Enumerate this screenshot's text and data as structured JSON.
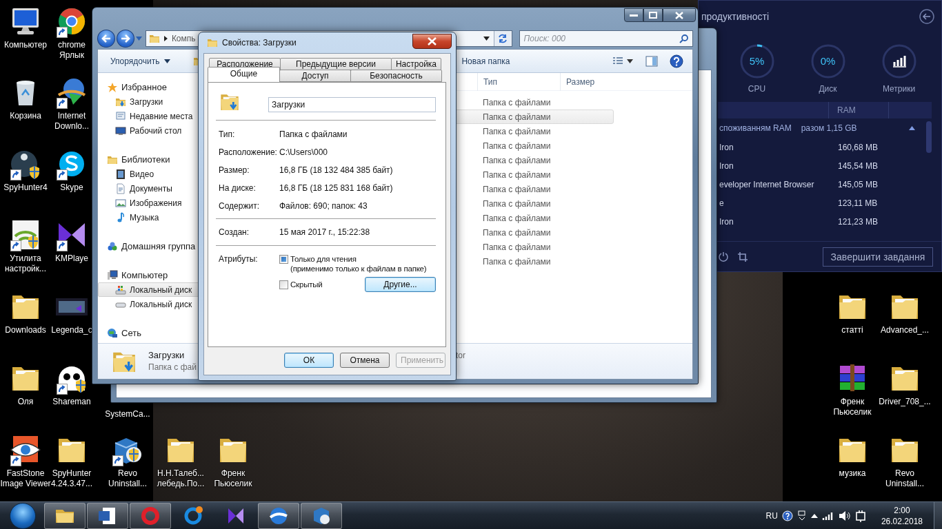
{
  "desktop_icons": [
    {
      "label": "Компьютер",
      "kind": "program",
      "shortcut": false
    },
    {
      "label": "Корзина",
      "kind": "program",
      "shortcut": false
    },
    {
      "label": "SpyHunter4",
      "kind": "program",
      "shortcut": true
    },
    {
      "label": "Утилита\nнастройк...",
      "kind": "program",
      "shortcut": true
    },
    {
      "label": "Downloads",
      "kind": "folder",
      "shortcut": false
    },
    {
      "label": "Оля",
      "kind": "folder",
      "shortcut": false
    },
    {
      "label": "FastStone\nImage Viewer",
      "kind": "program",
      "shortcut": true
    },
    {
      "label": "chrome\nЯрлык",
      "kind": "program",
      "shortcut": true
    },
    {
      "label": "Internet\nDownlo...",
      "kind": "program",
      "shortcut": true
    },
    {
      "label": "Skype",
      "kind": "program",
      "shortcut": true
    },
    {
      "label": "KMPlaye",
      "kind": "program",
      "shortcut": true
    },
    {
      "label": "Legenda_c",
      "kind": "program",
      "shortcut": false
    },
    {
      "label": "Shareman",
      "kind": "program",
      "shortcut": true
    },
    {
      "label": "SpyHunter\n4.24.3.47...",
      "kind": "folder",
      "shortcut": false
    },
    {
      "label": "SystemCa...",
      "kind": "label",
      "shortcut": false
    },
    {
      "label": "Revo\nUninstall...",
      "kind": "program",
      "shortcut": true
    },
    {
      "label": "Н.Н.Талеб...\nлебедь.По...",
      "kind": "folder",
      "shortcut": false
    },
    {
      "label": "Френк\nПьюселик",
      "kind": "folder",
      "shortcut": false
    },
    {
      "label": "статті",
      "kind": "folder",
      "shortcut": false
    },
    {
      "label": "Advanced_...",
      "kind": "folder",
      "shortcut": false
    },
    {
      "label": "Френк\nПьюселик",
      "kind": "program",
      "shortcut": false
    },
    {
      "label": "Driver_708_...",
      "kind": "folder",
      "shortcut": false
    },
    {
      "label": "музика",
      "kind": "folder",
      "shortcut": false
    },
    {
      "label": "Revo\nUninstall...",
      "kind": "folder",
      "shortcut": false
    }
  ],
  "panel": {
    "title": "продуктивності",
    "gauges": [
      {
        "kind": "gauge",
        "reading": "5%",
        "label": "CPU",
        "level": 0.05
      },
      {
        "kind": "gauge",
        "reading": "0%",
        "label": "Диск"
      },
      {
        "kind": "chart",
        "label": "Метрики"
      }
    ],
    "column": "RAM",
    "group": {
      "label": "споживанням RAM",
      "total": "разом 1,15 GB",
      "expanded": true
    },
    "rows": [
      {
        "name": "Iron",
        "ram": "160,68 MB"
      },
      {
        "name": "Iron",
        "ram": "145,54 MB"
      },
      {
        "name": "eveloper Internet Browser",
        "ram": "145,05 MB"
      },
      {
        "name": "e",
        "ram": "123,11 MB"
      },
      {
        "name": "Iron",
        "ram": "121,23 MB"
      }
    ],
    "end_task": "Завершити завдання"
  },
  "explorer": {
    "address": "Компь",
    "search": {
      "placeholder": "Поиск: 000"
    },
    "toolbar": {
      "organize": "Упорядочить",
      "new_folder": "Новая папка"
    },
    "sidebar": [
      {
        "label": "Избранное",
        "selected": false,
        "children": [
          {
            "label": "Загрузки",
            "selected": false
          },
          {
            "label": "Недавние места",
            "selected": false
          },
          {
            "label": "Рабочий стол",
            "selected": false
          }
        ]
      },
      {
        "label": "Библиотеки",
        "selected": false,
        "children": [
          {
            "label": "Видео",
            "selected": false
          },
          {
            "label": "Документы",
            "selected": false
          },
          {
            "label": "Изображения",
            "selected": false
          },
          {
            "label": "Музыка",
            "selected": false
          }
        ]
      },
      {
        "label": "Домашняя группа",
        "selected": false
      },
      {
        "label": "Компьютер",
        "selected": false,
        "children": [
          {
            "label": "Локальный диск",
            "selected": true
          },
          {
            "label": "Локальный диск",
            "selected": false
          }
        ]
      },
      {
        "label": "Сеть",
        "selected": false
      }
    ],
    "columns": [
      "Тип",
      "Размер"
    ],
    "rows": [
      {
        "type": "Папка с файлами",
        "selected": false
      },
      {
        "type": "Папка с файлами",
        "selected": true
      },
      {
        "type": "Папка с файлами",
        "selected": false
      },
      {
        "type": "Папка с файлами",
        "selected": false
      },
      {
        "type": "Папка с файлами",
        "selected": false
      },
      {
        "type": "Папка с файлами",
        "selected": false
      },
      {
        "type": "Папка с файлами",
        "selected": false
      },
      {
        "type": "Папка с файлами",
        "selected": false
      },
      {
        "type": "Папка с файлами",
        "selected": false
      },
      {
        "type": "Папка с файлами",
        "selected": false
      },
      {
        "type": "Папка с файлами",
        "selected": false
      },
      {
        "type": "Папка с файлами",
        "selected": false
      }
    ],
    "details": {
      "name": "Загрузки",
      "type": "Папка с фай",
      "field_3": "tor"
    }
  },
  "dialog": {
    "title": "Свойства: Загрузки",
    "tab_rows": [
      {
        "tabs": [
          {
            "label": "Расположение",
            "selected": false
          },
          {
            "label": "Предыдущие версии",
            "selected": false
          },
          {
            "label": "Настройка",
            "selected": false
          }
        ]
      },
      {
        "tabs": [
          {
            "label": "Общие",
            "selected": true
          },
          {
            "label": "Доступ",
            "selected": false
          },
          {
            "label": "Безопасность",
            "selected": false
          }
        ]
      }
    ],
    "name": "Загрузки",
    "property_groups": [
      {
        "items": [
          {
            "label": "Тип:",
            "value": "Папка с файлами"
          },
          {
            "label": "Расположение:",
            "value": "C:\\Users\\000"
          },
          {
            "label": "Размер:",
            "value": "16,8 ГБ (18 132 484 385 байт)"
          },
          {
            "label": "На диске:",
            "value": "16,8 ГБ (18 125 831 168 байт)"
          },
          {
            "label": "Содержит:",
            "value": "Файлов: 690; папок: 43"
          }
        ]
      },
      {
        "items": [
          {
            "label": "Создан:",
            "value": "15 мая 2017 г., 15:22:38"
          }
        ]
      }
    ],
    "attributes": {
      "label": "Атрибуты:",
      "options": [
        {
          "label": "Только для чтения",
          "note": "(применимо только к файлам в папке)",
          "checked": false,
          "indeterminate": true
        },
        {
          "label": "Скрытый",
          "checked": false,
          "indeterminate": false
        }
      ],
      "advanced_button": "Другие..."
    },
    "buttons": [
      {
        "label": "ОК",
        "default": true,
        "disabled": false
      },
      {
        "label": "Отмена",
        "default": false,
        "disabled": false
      },
      {
        "label": "Применить",
        "default": false,
        "disabled": true
      }
    ]
  },
  "taskbar": {
    "buttons": [
      {
        "running": true
      },
      {
        "running": true
      },
      {
        "running": true
      },
      {
        "running": false
      },
      {
        "running": false
      },
      {
        "running": true
      },
      {
        "running": true
      }
    ],
    "language": "RU",
    "time": "2:00",
    "date": "26.02.2018"
  }
}
